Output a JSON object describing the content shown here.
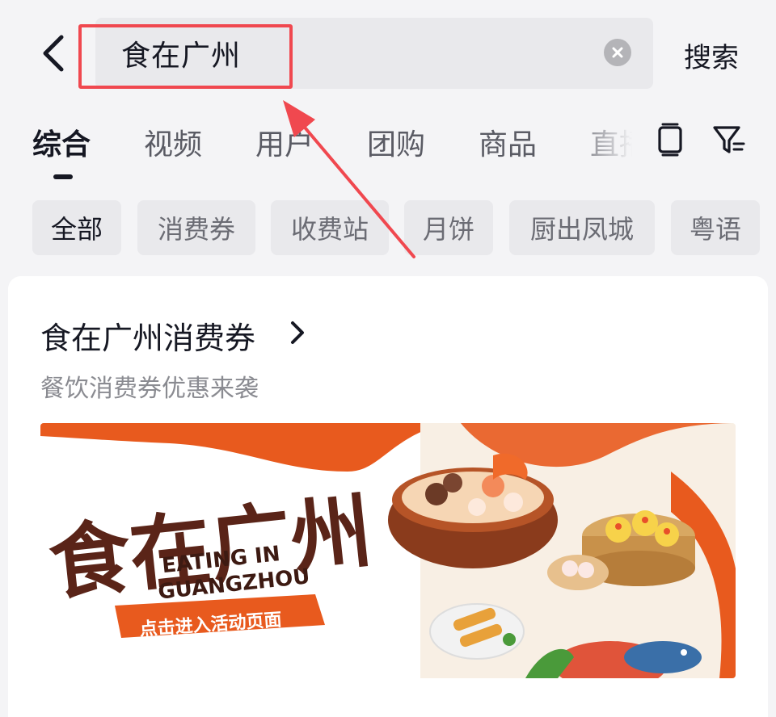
{
  "search": {
    "query": "食在广州",
    "submit_label": "搜索"
  },
  "tabs": [
    {
      "label": "综合",
      "active": true
    },
    {
      "label": "视频"
    },
    {
      "label": "用户"
    },
    {
      "label": "团购"
    },
    {
      "label": "商品"
    },
    {
      "label": "直播"
    }
  ],
  "chips": [
    {
      "label": "全部",
      "active": true
    },
    {
      "label": "消费券"
    },
    {
      "label": "收费站"
    },
    {
      "label": "月饼"
    },
    {
      "label": "厨出凤城"
    },
    {
      "label": "粤语"
    }
  ],
  "card": {
    "title": "食在广州消费券",
    "subtitle": "餐饮消费券优惠来袭",
    "banner": {
      "logo_text": "食在广州",
      "logo_en_line1": "EATING IN",
      "logo_en_line2": "GUANGZHOU",
      "cta_label": "点击进入活动页面"
    }
  },
  "colors": {
    "accent_red": "#f0484f",
    "banner_orange": "#e85a1e",
    "logo_brown": "#5a2418"
  },
  "icons": [
    "back-arrow-icon",
    "clear-icon",
    "tablet-icon",
    "filter-icon",
    "chevron-right-icon"
  ]
}
